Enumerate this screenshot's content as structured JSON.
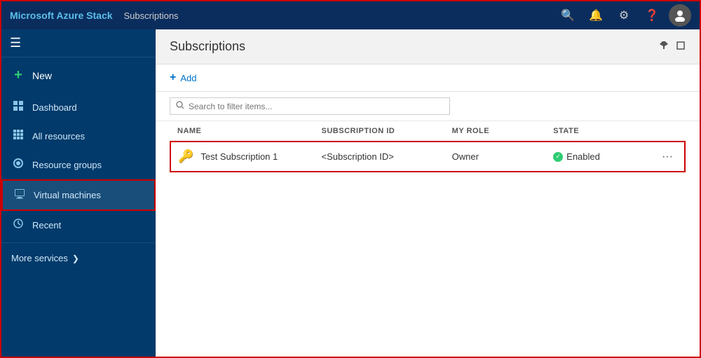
{
  "header": {
    "app_title": "Microsoft Azure Stack",
    "page_title": "Subscriptions",
    "icons": {
      "search": "🔍",
      "bell": "🔔",
      "gear": "⚙",
      "help": "❓"
    }
  },
  "content_header": {
    "title": "Subscriptions",
    "pin_icon": "📌",
    "window_icon": "⬜"
  },
  "toolbar": {
    "add_label": "Add"
  },
  "search": {
    "placeholder": "Search to filter items..."
  },
  "table": {
    "columns": [
      "NAME",
      "SUBSCRIPTION ID",
      "MY ROLE",
      "STATE"
    ],
    "rows": [
      {
        "name": "Test Subscription 1",
        "subscription_id": "<Subscription ID>",
        "role": "Owner",
        "state": "Enabled"
      }
    ]
  },
  "sidebar": {
    "hamburger": "☰",
    "items": [
      {
        "id": "new",
        "label": "New",
        "icon": "+"
      },
      {
        "id": "dashboard",
        "label": "Dashboard",
        "icon": "▦"
      },
      {
        "id": "all-resources",
        "label": "All resources",
        "icon": "⊞"
      },
      {
        "id": "resource-groups",
        "label": "Resource groups",
        "icon": "◉"
      },
      {
        "id": "virtual-machines",
        "label": "Virtual machines",
        "icon": "🖥"
      },
      {
        "id": "recent",
        "label": "Recent",
        "icon": "🕐"
      }
    ],
    "more_services": "More services",
    "more_services_chevron": "❯"
  }
}
